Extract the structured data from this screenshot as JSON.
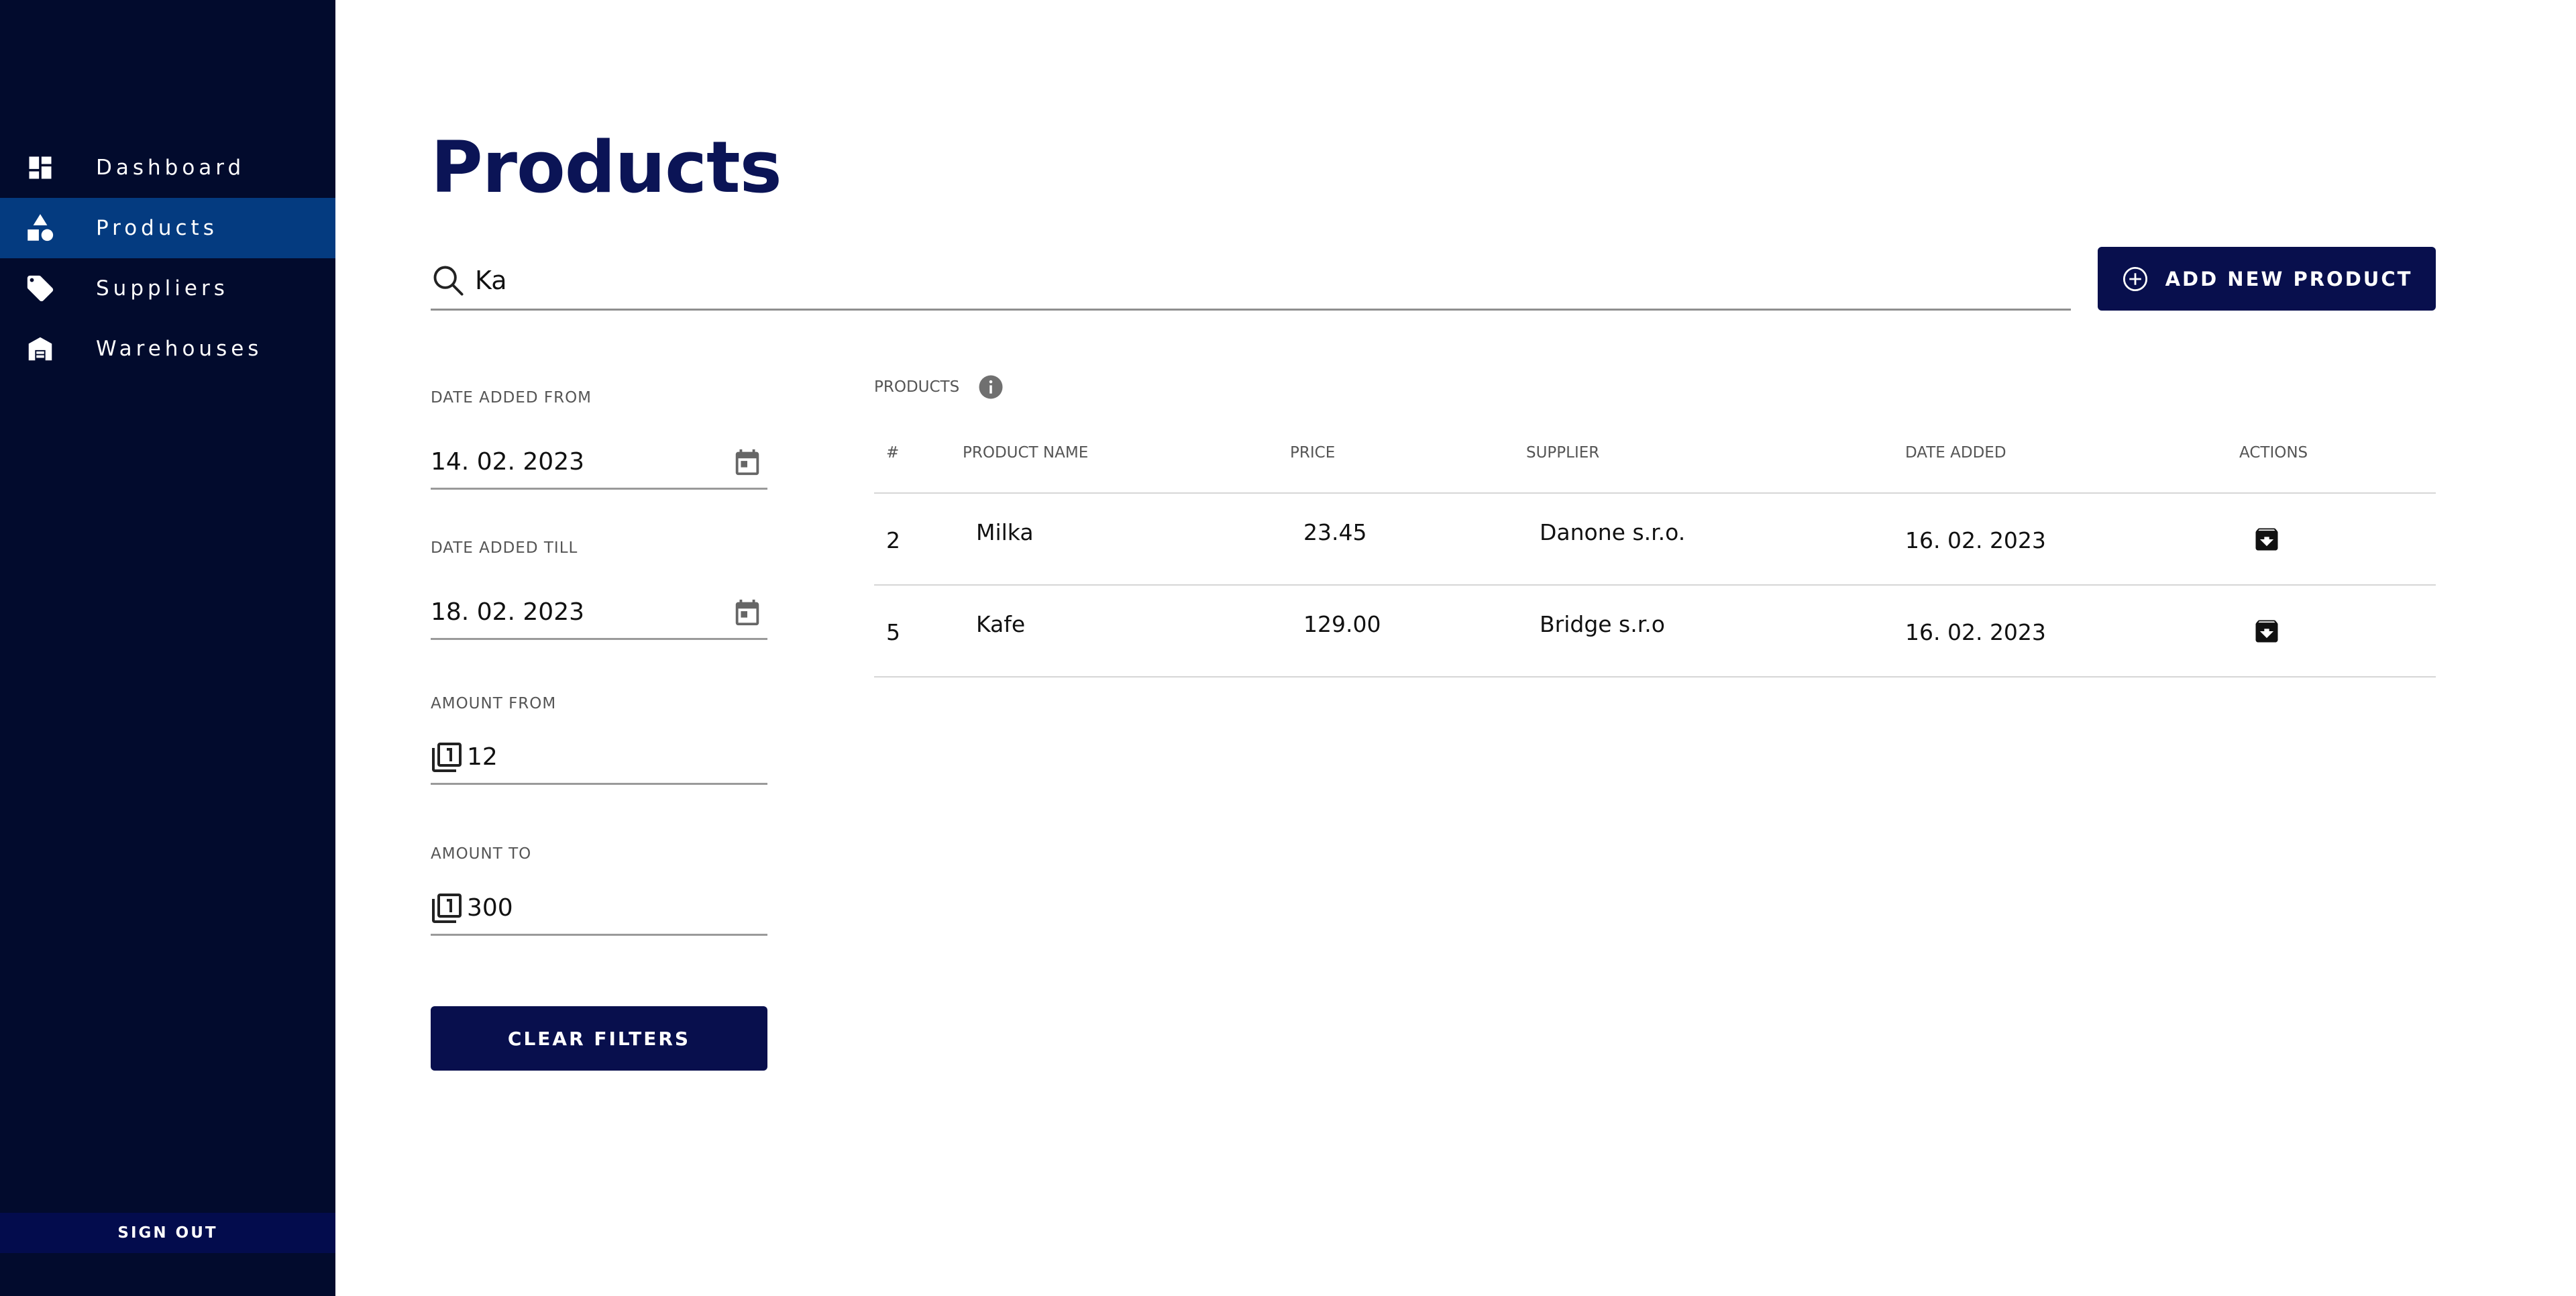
{
  "sidebar": {
    "items": [
      {
        "label": "Dashboard",
        "icon": "dashboard-icon",
        "active": false
      },
      {
        "label": "Products",
        "icon": "shapes-icon",
        "active": true
      },
      {
        "label": "Suppliers",
        "icon": "tag-icon",
        "active": false
      },
      {
        "label": "Warehouses",
        "icon": "warehouse-icon",
        "active": false
      }
    ],
    "sign_out_label": "SIGN OUT"
  },
  "page": {
    "title": "Products"
  },
  "search": {
    "value": "Ka",
    "icon": "search-icon"
  },
  "toolbar": {
    "add_label": "ADD NEW PRODUCT",
    "add_icon": "add-circle-icon"
  },
  "filters": {
    "date_from": {
      "label": "DATE ADDED FROM",
      "value": "14. 02. 2023",
      "icon": "calendar-icon"
    },
    "date_till": {
      "label": "DATE ADDED TILL",
      "value": "18. 02. 2023",
      "icon": "calendar-icon"
    },
    "amount_from": {
      "label": "AMOUNT FROM",
      "value": "12",
      "icon": "stack-icon"
    },
    "amount_to": {
      "label": "AMOUNT TO",
      "value": "300",
      "icon": "stack-icon"
    },
    "clear_label": "CLEAR FILTERS"
  },
  "table": {
    "caption": "PRODUCTS",
    "headers": {
      "id": "#",
      "name": "PRODUCT NAME",
      "price": "PRICE",
      "supplier": "SUPPLIER",
      "date": "DATE ADDED",
      "actions": "ACTIONS"
    },
    "rows": [
      {
        "id": "2",
        "name": "Milka",
        "price": "23.45",
        "supplier": "Danone s.r.o.",
        "date": "16. 02. 2023",
        "action_icon": "archive-icon"
      },
      {
        "id": "5",
        "name": "Kafe",
        "price": "129.00",
        "supplier": "Bridge s.r.o",
        "date": "16. 02. 2023",
        "action_icon": "archive-icon"
      }
    ]
  },
  "colors": {
    "sidebar_bg": "#020b2d",
    "active_item": "#043b80",
    "button_bg": "#080f4d",
    "title": "#0b1456"
  }
}
